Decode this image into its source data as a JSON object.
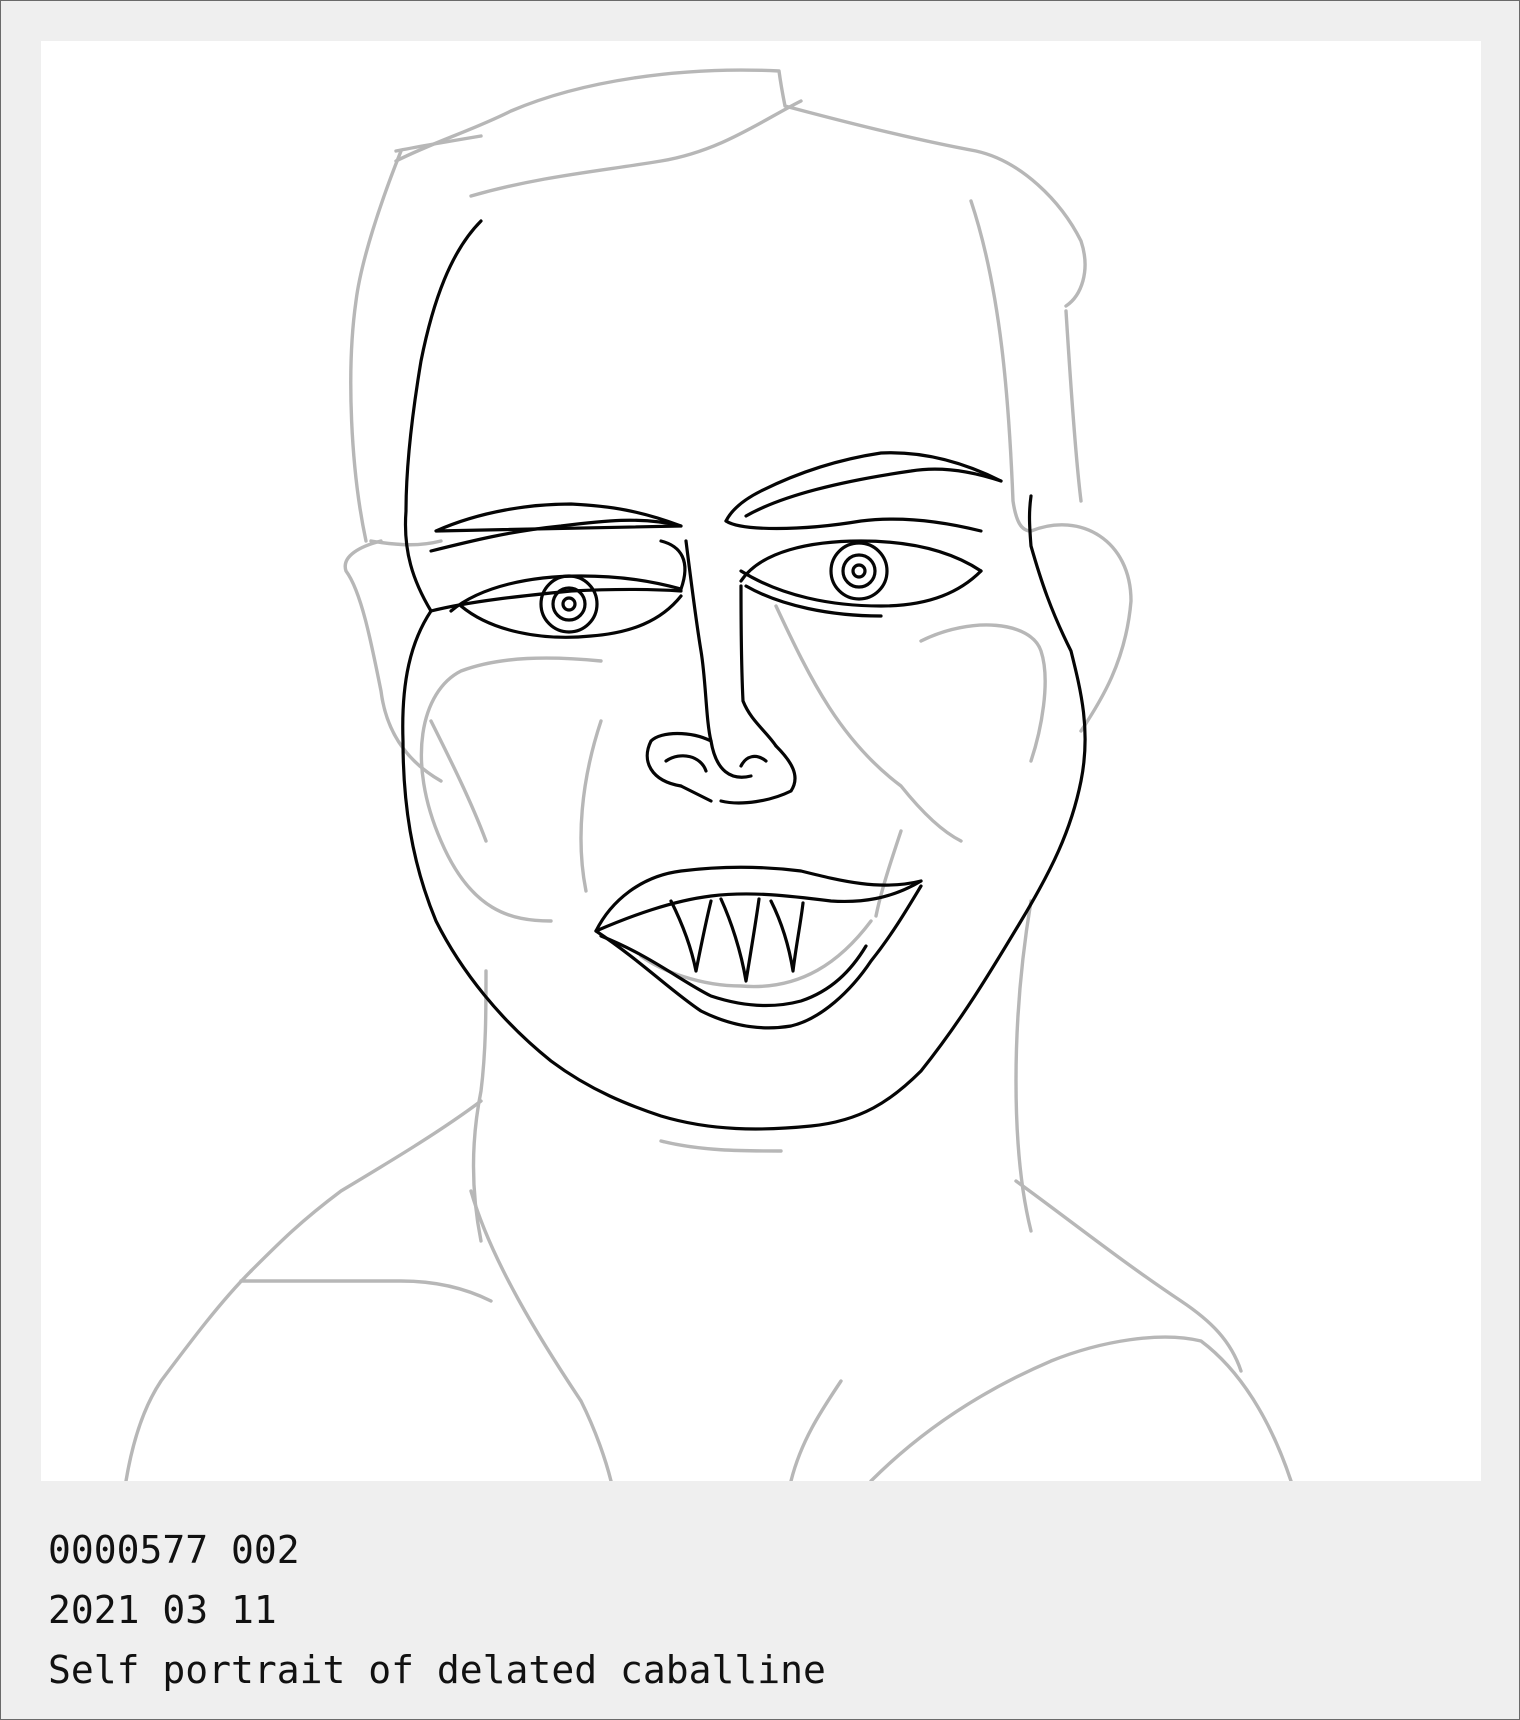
{
  "caption": {
    "id_line": "0000577 002",
    "date_line": "2021 03 11",
    "title_line": "Self portrait of delated caballine"
  },
  "colors": {
    "card_background": "#efefef",
    "art_background": "#ffffff",
    "sketch_line": "#b7b7b7",
    "ink_line": "#050505",
    "text": "#111111"
  }
}
